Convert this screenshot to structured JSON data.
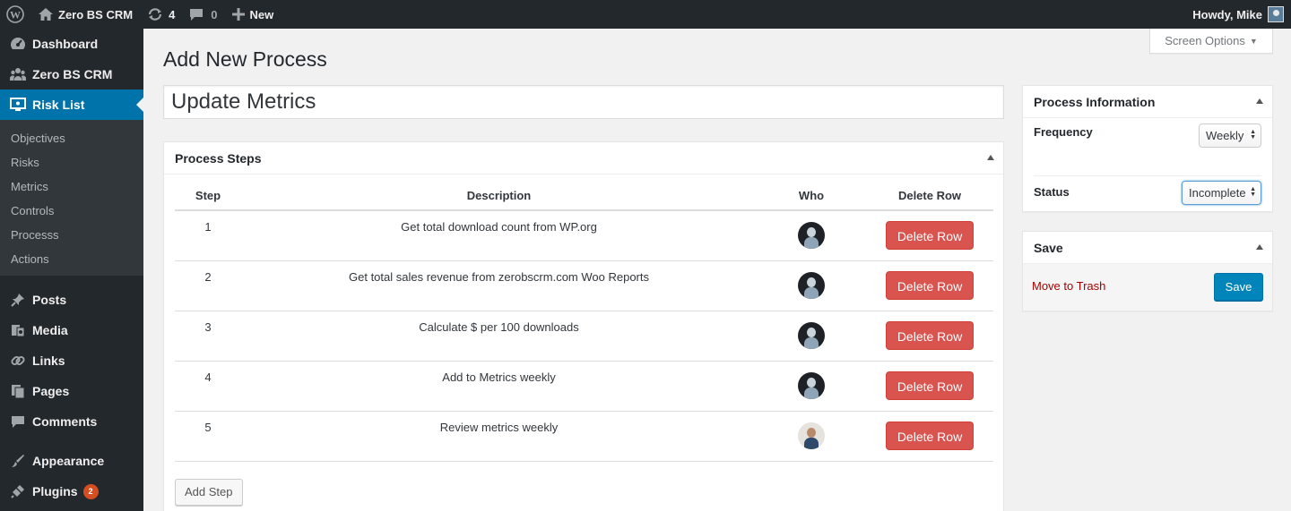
{
  "admin_bar": {
    "site_name": "Zero BS CRM",
    "updates_count": "4",
    "comments_count": "0",
    "new_label": "New",
    "greeting": "Howdy, Mike"
  },
  "menu": {
    "items_top": [
      {
        "label": "Dashboard",
        "icon": "dashboard-icon"
      },
      {
        "label": "Zero BS CRM",
        "icon": "groups-icon"
      },
      {
        "label": "Risk List",
        "icon": "screen-icon",
        "current": true
      }
    ],
    "submenu": [
      "Objectives",
      "Risks",
      "Metrics",
      "Controls",
      "Processs",
      "Actions"
    ],
    "items_bottom": [
      {
        "label": "Posts",
        "icon": "pin-icon"
      },
      {
        "label": "Media",
        "icon": "media-icon"
      },
      {
        "label": "Links",
        "icon": "link-icon"
      },
      {
        "label": "Pages",
        "icon": "pages-icon"
      },
      {
        "label": "Comments",
        "icon": "comment-icon"
      }
    ],
    "items_more": [
      {
        "label": "Appearance",
        "icon": "brush-icon"
      },
      {
        "label": "Plugins",
        "icon": "plugin-icon",
        "badge": "2"
      }
    ]
  },
  "screen_options": "Screen Options",
  "page_title": "Add New Process",
  "title_value": "Update Metrics",
  "steps_box": {
    "title": "Process Steps",
    "headers": {
      "step": "Step",
      "description": "Description",
      "who": "Who",
      "delete": "Delete Row"
    },
    "rows": [
      {
        "step": "1",
        "description": "Get total download count from WP.org",
        "who": "user-avatar-mike"
      },
      {
        "step": "2",
        "description": "Get total sales revenue from zerobscrm.com Woo Reports",
        "who": "user-avatar-mike"
      },
      {
        "step": "3",
        "description": "Calculate $ per 100 downloads",
        "who": "user-avatar-mike"
      },
      {
        "step": "4",
        "description": "Add to Metrics weekly",
        "who": "user-avatar-mike"
      },
      {
        "step": "5",
        "description": "Review metrics weekly",
        "who": "user-avatar-other"
      }
    ],
    "delete_label": "Delete Row",
    "add_step_label": "Add Step"
  },
  "info_box": {
    "title": "Process Information",
    "frequency_label": "Frequency",
    "frequency_value": "Weekly",
    "status_label": "Status",
    "status_value": "Incomplete"
  },
  "save_box": {
    "title": "Save",
    "trash_label": "Move to Trash",
    "save_label": "Save"
  },
  "colors": {
    "admin_bar": "#23282d",
    "menu_current": "#0073aa",
    "delete_button": "#d9534f",
    "primary_button": "#0085ba",
    "trash_link": "#a00"
  }
}
